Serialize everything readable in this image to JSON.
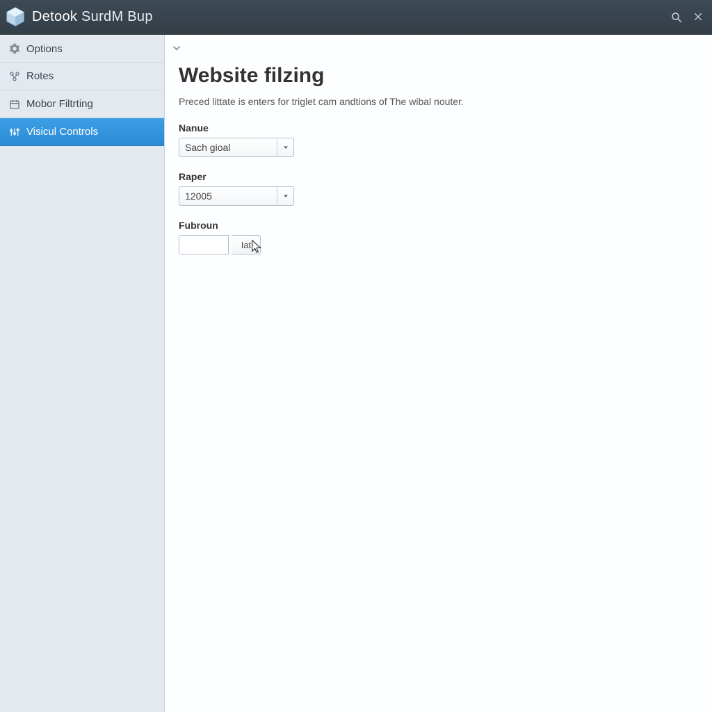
{
  "header": {
    "title_strong": "Detook",
    "title_rest": "SurdM Bup"
  },
  "sidebar": {
    "items": [
      {
        "label": "Options",
        "active": false
      },
      {
        "label": "Rotes",
        "active": false
      },
      {
        "label": "Mobor Filtrting",
        "active": false
      },
      {
        "label": "Visicul Controls",
        "active": true
      }
    ]
  },
  "main": {
    "page_title": "Website filzing",
    "description": "Preced littate is enters for triglet cam andtions of The wibal nouter.",
    "fields": {
      "name": {
        "label": "Nanue",
        "value": "Sach gioal"
      },
      "raper": {
        "label": "Raper",
        "value": "12005"
      },
      "fubroun": {
        "label": "Fubroun",
        "value": "",
        "addon": "Iat"
      }
    }
  }
}
